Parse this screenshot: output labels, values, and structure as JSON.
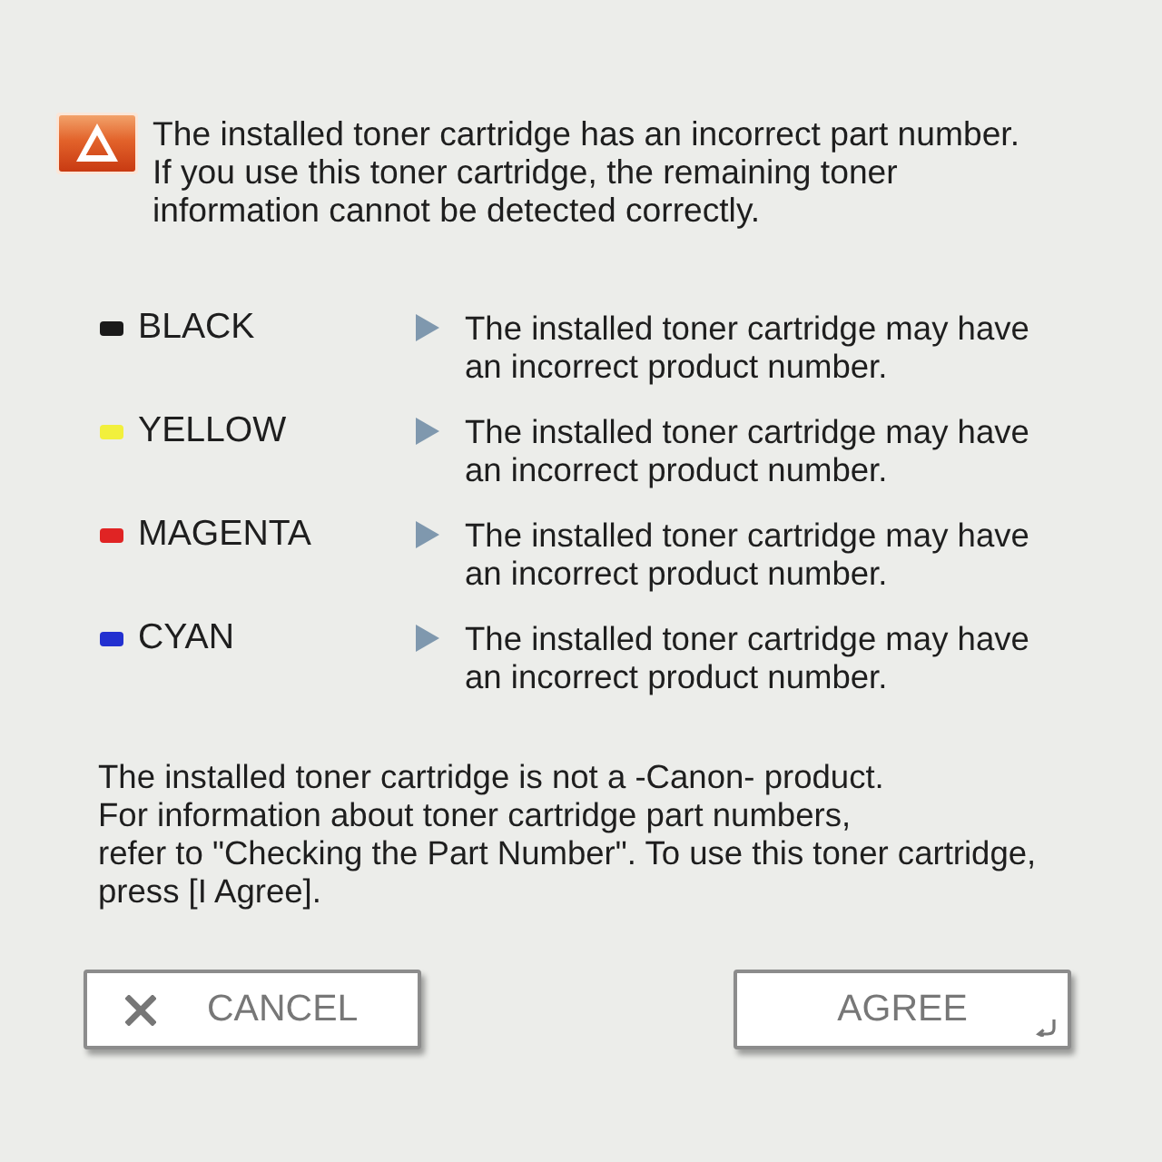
{
  "message": {
    "lines": [
      "The installed toner cartridge has an incorrect part number.",
      "If you use this toner cartridge, the remaining toner",
      "information cannot be detected correctly."
    ]
  },
  "toners": [
    {
      "name": "BLACK",
      "color": "#1a1a1a",
      "detail": [
        "The installed toner cartridge may have",
        "an incorrect product number."
      ]
    },
    {
      "name": "YELLOW",
      "color": "#f2f03c",
      "detail": [
        "The installed toner cartridge may have",
        "an incorrect product number."
      ]
    },
    {
      "name": "MAGENTA",
      "color": "#e02424",
      "detail": [
        "The installed toner cartridge may have",
        "an incorrect product number."
      ]
    },
    {
      "name": "CYAN",
      "color": "#2230d0",
      "detail": [
        "The installed toner cartridge may have",
        "an incorrect product number."
      ]
    }
  ],
  "note": {
    "lines": [
      "The installed toner cartridge is not a -Canon- product.",
      "For information about toner cartridge part numbers,",
      "refer to \"Checking the Part Number\". To use this toner cartridge,",
      "press [I Agree]."
    ]
  },
  "buttons": [
    {
      "kind": "cancel",
      "label": "CANCEL"
    },
    {
      "kind": "agree",
      "label": "AGREE"
    }
  ]
}
